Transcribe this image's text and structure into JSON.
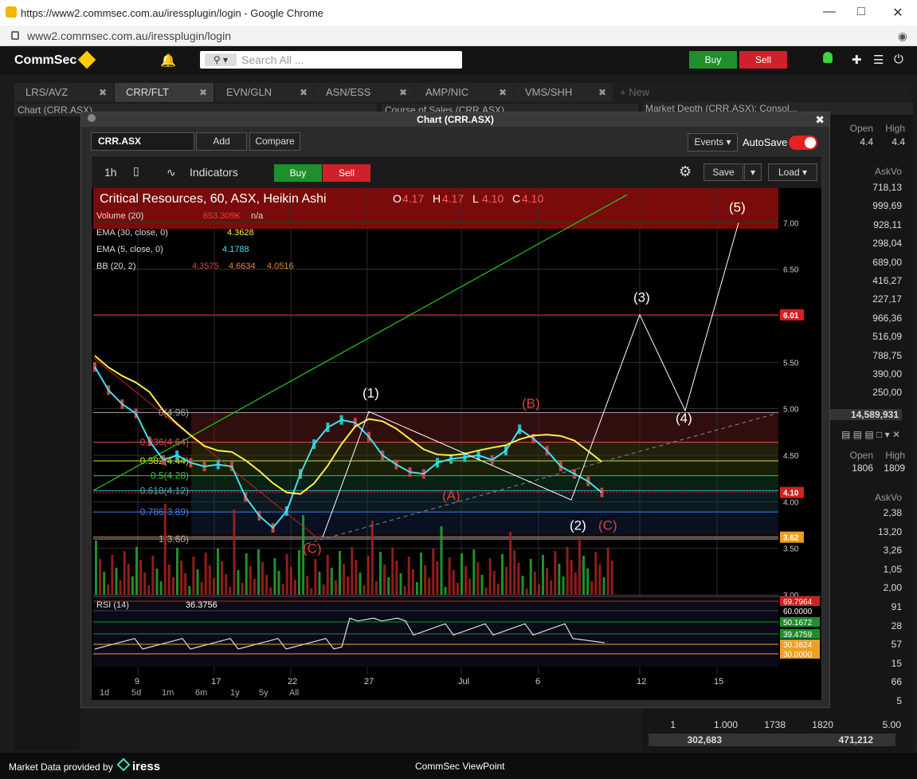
{
  "browser": {
    "window_title": "https://www2.commsec.com.au/iressplugin/login - Google Chrome",
    "url": "www2.commsec.com.au/iressplugin/login"
  },
  "app": {
    "logo": "CommSec",
    "search_placeholder": "Search All ...",
    "buy_label": "Buy",
    "sell_label": "Sell"
  },
  "tabs": [
    {
      "label": "LRS/AVZ",
      "active": false
    },
    {
      "label": "CRR/FLT",
      "active": true
    },
    {
      "label": "EVN/GLN",
      "active": false
    },
    {
      "label": "ASN/ESS",
      "active": false
    },
    {
      "label": "AMP/NIC",
      "active": false
    },
    {
      "label": "VMS/SHH",
      "active": false
    }
  ],
  "tab_new_label": "+ New",
  "panels": {
    "chart_header": "Chart (CRR.ASX)",
    "course_of_sales": "Course of Sales (CRR.ASX)",
    "market_depth": "Market Depth (CRR.ASX): Consol..."
  },
  "market_depth_top": {
    "headers": [
      "Open",
      "High"
    ],
    "values": [
      "4.4",
      "4.4"
    ],
    "askvol_header": "AskVo",
    "rows": [
      "718,13",
      "999,69",
      "928,11",
      "298,04",
      "689,00",
      "416,27",
      "227,17",
      "966,36",
      "516,09",
      "788,75",
      "390,00",
      "250,00"
    ],
    "total": "14,589,931"
  },
  "market_depth_bottom": {
    "headers": [
      "Open",
      "High"
    ],
    "values": [
      "1806",
      "1809"
    ],
    "askvol_header": "AskVo",
    "rows": [
      "2,38",
      "13,20",
      "3,26",
      "1,05",
      "2,00",
      "91",
      "28",
      "57",
      "15",
      "66",
      "5"
    ],
    "footer_row": [
      "1",
      "1.000",
      "1738",
      "1820",
      "5.00"
    ],
    "totals": [
      "302,683",
      "471,212"
    ]
  },
  "modal": {
    "title": "Chart (CRR.ASX)",
    "symbol": "CRR.ASX",
    "add_label": "Add",
    "compare_label": "Compare",
    "events_label": "Events",
    "autosave_label": "AutoSave",
    "interval": "1h",
    "indicators_label": "Indicators",
    "buy_label": "Buy",
    "sell_label": "Sell",
    "save_label": "Save",
    "load_label": "Load",
    "ranges": [
      "1d",
      "5d",
      "1m",
      "6m",
      "1y",
      "5y",
      "All"
    ]
  },
  "chart_data": {
    "type": "candlestick",
    "title": "Critical Resources, 60, ASX, Heikin Ashi",
    "ohlc": {
      "O": "4.17",
      "H": "4.17",
      "L": "4.10",
      "C": "4.10"
    },
    "legend": [
      {
        "label": "Volume (20)",
        "value": "653.309K",
        "extra": "n/a",
        "color": "#e04040"
      },
      {
        "label": "EMA (30, close, 0)",
        "value": "4.3628",
        "color": "#ffee44"
      },
      {
        "label": "EMA (5, close, 0)",
        "value": "4.1788",
        "color": "#44e0f0"
      },
      {
        "label": "BB (20, 2)",
        "values": [
          "4.3575",
          "4.6634",
          "4.0516"
        ],
        "colors": [
          "#e04040",
          "#e08a2a",
          "#e08a2a"
        ]
      }
    ],
    "y_ticks": [
      "7.00",
      "6.50",
      "6.00",
      "5.50",
      "5.00",
      "4.50",
      "4.00",
      "3.50",
      "3.00"
    ],
    "ylim": [
      3.0,
      7.2
    ],
    "x_ticks": [
      "9",
      "17",
      "22",
      "27",
      "Jul",
      "6",
      "12",
      "15"
    ],
    "price_labels": [
      {
        "value": "6.01",
        "color": "#d42020"
      },
      {
        "value": "4.10",
        "color": "#d42020"
      },
      {
        "value": "3.62",
        "color": "#f0a020"
      }
    ],
    "fib_levels": [
      {
        "label": "0(4.96)",
        "value": 4.96,
        "color": "#aaaaaa"
      },
      {
        "label": "0.236(4.64)",
        "value": 4.64,
        "color": "#e05050"
      },
      {
        "label": "0.382(4.44)",
        "value": 4.44,
        "color": "#c8e030"
      },
      {
        "label": "0.5(4.28)",
        "value": 4.28,
        "color": "#40c040"
      },
      {
        "label": "0.618(4.12)",
        "value": 4.12,
        "color": "#40b0b0"
      },
      {
        "label": "0.786(3.89)",
        "value": 3.89,
        "color": "#4080e0"
      },
      {
        "label": "1(3.60)",
        "value": 3.6,
        "color": "#aaaaaa"
      }
    ],
    "wave_labels": [
      {
        "label": "(1)",
        "color": "#ffffff"
      },
      {
        "label": "(2)",
        "color": "#ffffff"
      },
      {
        "label": "(3)",
        "color": "#ffffff"
      },
      {
        "label": "(4)",
        "color": "#ffffff"
      },
      {
        "label": "(5)",
        "color": "#ffffff"
      },
      {
        "label": "(A)",
        "color": "#e04040"
      },
      {
        "label": "(B)",
        "color": "#e04040"
      },
      {
        "label": "(C)",
        "color": "#e04040"
      },
      {
        "label": "(C)",
        "color": "#e04040"
      }
    ],
    "rsi": {
      "label": "RSI (14)",
      "value": "36.3756",
      "levels": [
        {
          "value": "69.7964",
          "color": "#d42020"
        },
        {
          "value": "60.0000",
          "color": "#000000"
        },
        {
          "value": "50.1672",
          "color": "#1f8f2a"
        },
        {
          "value": "39.4759",
          "color": "#1f8f2a"
        },
        {
          "value": "30.3824",
          "color": "#f0a020"
        },
        {
          "value": "30.0000",
          "color": "#f0a020"
        }
      ]
    }
  },
  "footer": {
    "provider": "Market Data provided by",
    "brand": "iress",
    "app_name": "CommSec ViewPoint"
  }
}
